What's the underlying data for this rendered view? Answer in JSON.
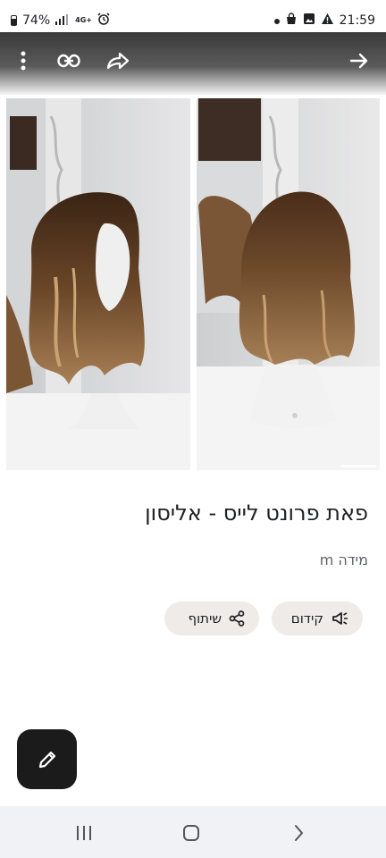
{
  "status_bar": {
    "battery_percent": "74%",
    "network": "4G+",
    "time": "21:59"
  },
  "toolbar": {
    "icons": [
      "more-vert-icon",
      "link-icon",
      "share-forward-icon",
      "forward-arrow-icon"
    ]
  },
  "gallery": {
    "image_count": 2,
    "current_index": 2
  },
  "listing": {
    "title": "פאת פרונט לייס - אליסון",
    "size": "מידה m"
  },
  "actions": {
    "promote_label": "קידום",
    "share_label": "שיתוף"
  },
  "fab": {
    "icon": "pencil-icon"
  },
  "colors": {
    "chip_bg": "#efebe8",
    "fab_bg": "#1b1b1b",
    "nav_bg": "#f0f2f5"
  }
}
